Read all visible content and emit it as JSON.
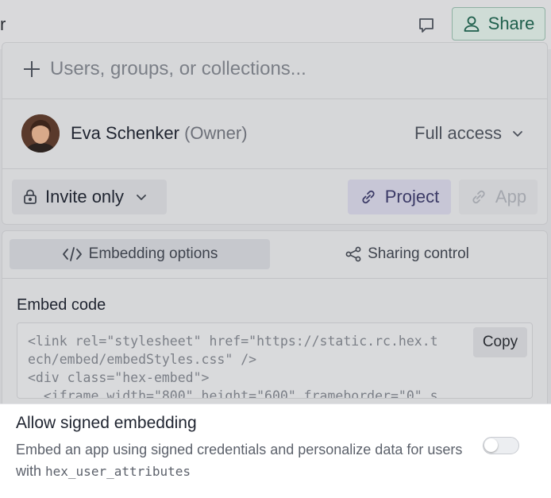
{
  "topbar": {
    "cut_text": "r",
    "share_label": "Share"
  },
  "share": {
    "add_placeholder": "Users, groups, or collections...",
    "owner": {
      "name": "Eva Schenker",
      "role": "(Owner)",
      "access": "Full access"
    },
    "invite_label": "Invite only",
    "project_label": "Project",
    "app_label": "App"
  },
  "embed": {
    "tabs": [
      "Embedding options",
      "Sharing control"
    ],
    "title": "Embed code",
    "code_lines": [
      "<link rel=\"stylesheet\" href=\"https://static.rc.hex.t",
      "ech/embed/embedStyles.css\" />",
      "<div class=\"hex-embed\">",
      "  <iframe width=\"800\" height=\"600\" frameborder=\"0\" s"
    ],
    "copy_label": "Copy"
  },
  "signed": {
    "title": "Allow signed embedding",
    "desc_text": "Embed an app using signed credentials and personalize data for users with ",
    "desc_code": "hex_user_attributes",
    "enabled": false
  },
  "colors": {
    "accent_green": "#1f5f4c",
    "project_purple": "#3b3a66"
  }
}
